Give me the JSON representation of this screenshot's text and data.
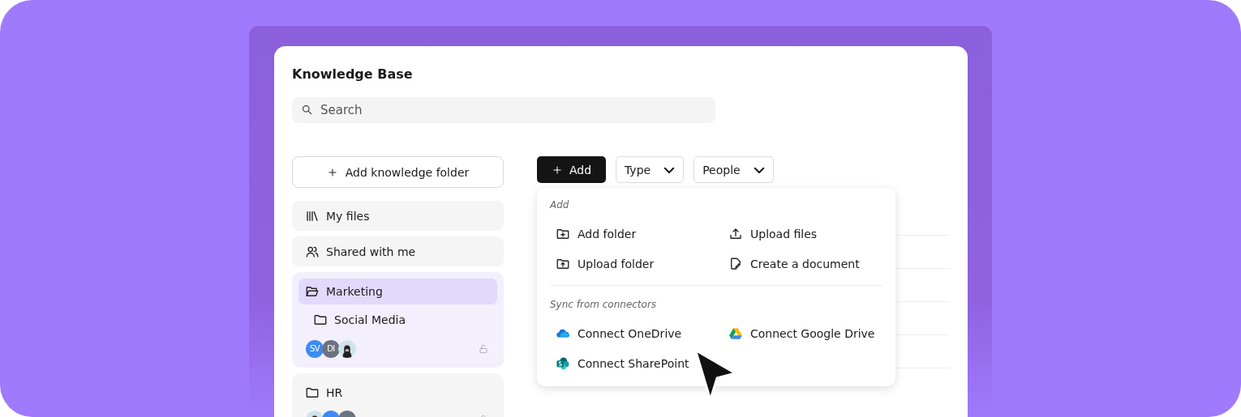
{
  "window": {
    "title": "Knowledge Base"
  },
  "search": {
    "placeholder": "Search"
  },
  "sidebar": {
    "add_button": "Add knowledge folder",
    "items": [
      {
        "label": "My files",
        "kind": "library"
      },
      {
        "label": "Shared with me",
        "kind": "shared"
      }
    ],
    "folders": [
      {
        "label": "Marketing",
        "expanded": true,
        "selected": true,
        "locked": false,
        "children": [
          {
            "label": "Social Media"
          }
        ],
        "members": [
          {
            "kind": "initials",
            "initials": "SV",
            "color": "#3d8bf2"
          },
          {
            "kind": "initials",
            "initials": "DI",
            "color": "#6b7280"
          },
          {
            "kind": "photo"
          }
        ]
      },
      {
        "label": "HR",
        "expanded": false,
        "selected": false,
        "locked": false,
        "members": [
          {
            "kind": "photo"
          },
          {
            "kind": "initials",
            "color": "#3d8bf2"
          },
          {
            "kind": "initials",
            "color": "#6b7280"
          }
        ]
      }
    ]
  },
  "toolbar": {
    "add_button": "Add",
    "filters": [
      "Type",
      "People"
    ]
  },
  "menu": {
    "sections": [
      {
        "title": "Add",
        "items": [
          {
            "label": "Add folder",
            "kind": "folder-plus"
          },
          {
            "label": "Upload files",
            "kind": "upload"
          },
          {
            "label": "Upload folder",
            "kind": "folder-upload"
          },
          {
            "label": "Create a document",
            "kind": "doc-edit"
          }
        ]
      },
      {
        "title": "Sync from connectors",
        "items": [
          {
            "label": "Connect OneDrive",
            "kind": "cloud"
          },
          {
            "label": "Connect Google Drive",
            "kind": "triangle"
          },
          {
            "label": "Connect SharePoint",
            "kind": "sharepoint"
          }
        ]
      }
    ]
  }
}
